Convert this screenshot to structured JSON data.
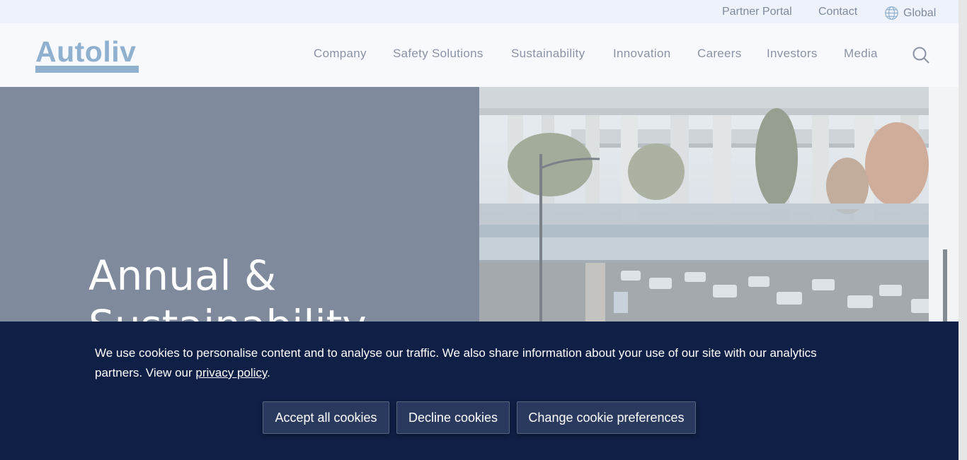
{
  "topbar": {
    "partner_portal": "Partner Portal",
    "contact": "Contact",
    "global": "Global",
    "global_icon": "globe-icon"
  },
  "brand": {
    "logo_text": "Autoliv",
    "color": "#8fb0cf"
  },
  "nav": {
    "items": [
      "Company",
      "Safety Solutions",
      "Sustainability",
      "Innovation",
      "Careers",
      "Investors",
      "Media"
    ],
    "search_icon": "search-icon"
  },
  "hero": {
    "title_line1": "Annual &",
    "title_line2": "Sustainability",
    "panel_color": "#7f8a9c"
  },
  "cookie_banner": {
    "text_before_link": "We use cookies to personalise content and to analyse our traffic. We also share information about your use of our site with our analytics partners. View our ",
    "link_text": "privacy policy",
    "text_after_link": ".",
    "buttons": {
      "accept": "Accept all cookies",
      "decline": "Decline cookies",
      "preferences": "Change cookie preferences"
    },
    "background": "#0f1f45"
  }
}
